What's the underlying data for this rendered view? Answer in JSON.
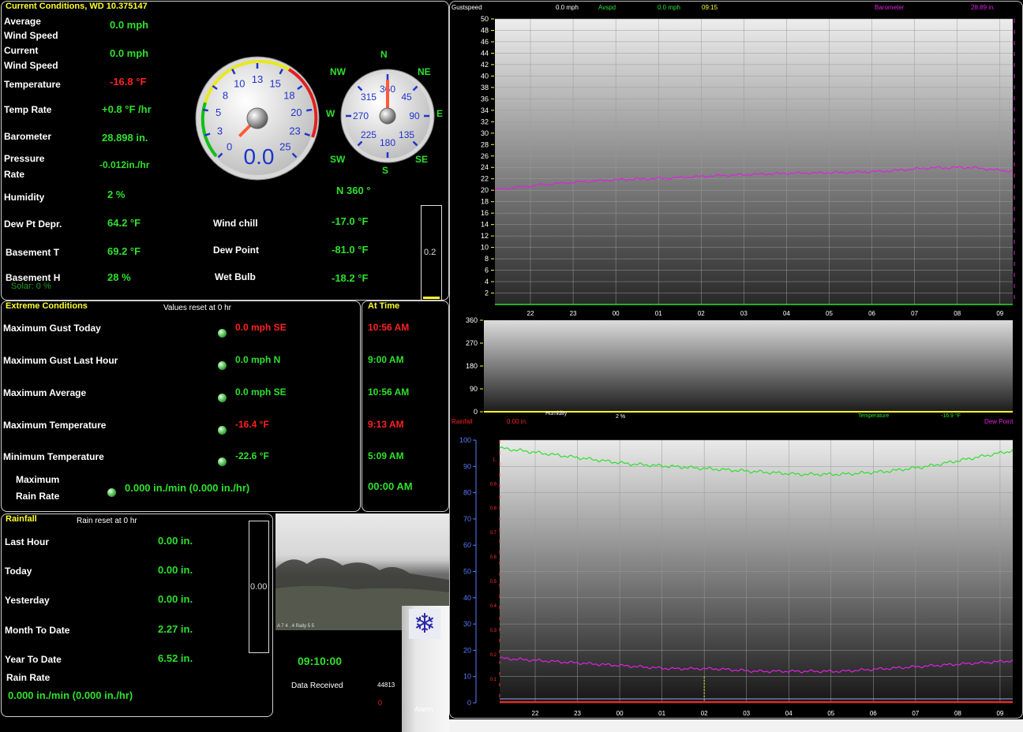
{
  "current": {
    "title": "Current Conditions, WD 10.375147",
    "avg_label_1": "Average",
    "avg_label_2": "Wind Speed",
    "avg_value": "0.0 mph",
    "cur_label_1": "Current",
    "cur_label_2": "Wind Speed",
    "cur_value": "0.0 mph",
    "temp_label": "Temperature",
    "temp_value": "-16.8 °F",
    "temprate_label": "Temp Rate",
    "temprate_value": "+0.8 °F /hr",
    "baro_label": "Barometer",
    "baro_value": "28.898 in.",
    "pres_label_1": "Pressure",
    "pres_label_2": "Rate",
    "pres_value": "-0.012in./hr",
    "hum_label": "Humidity",
    "hum_value": "2 %",
    "dew_depr_label": "Dew Pt Depr.",
    "dew_depr_value": "64.2 °F",
    "base_t_label": "Basement T",
    "base_t_value": "69.2 °F",
    "base_h_label": "Basement H",
    "base_h_value": "28 %",
    "solar": "Solar: 0 %",
    "windchill_label": "Wind chill",
    "windchill_value": "-17.0 °F",
    "dewpoint_label": "Dew Point",
    "dewpoint_value": "-81.0 °F",
    "wetbulb_label": "Wet Bulb",
    "wetbulb_value": "-18.2 °F",
    "speed_gauge": {
      "value": "0.0",
      "level": 0.0,
      "ticks": [
        "0",
        "3",
        "5",
        "8",
        "10",
        "13",
        "15",
        "18",
        "20",
        "23",
        "25"
      ]
    },
    "dir_gauge": {
      "readout": "N  360 °",
      "heading": 360,
      "ticks": [
        "360",
        "45",
        "90",
        "135",
        "180",
        "225",
        "270",
        "315"
      ],
      "compass": [
        "N",
        "NE",
        "E",
        "SE",
        "S",
        "SW",
        "W",
        "NW"
      ]
    },
    "solar_bar": {
      "value": "0.2",
      "level": 0.02
    }
  },
  "extreme": {
    "title": "Extreme Conditions",
    "reset_note": "Values reset at 0 hr",
    "at_time_title": "At Time",
    "rows": [
      {
        "label": "Maximum Gust Today",
        "value": "0.0 mph SE",
        "time": "10:56 AM",
        "value_color": "red",
        "time_color": "red"
      },
      {
        "label": "Maximum Gust Last Hour",
        "value": "0.0 mph  N",
        "time": "9:00 AM",
        "value_color": "green",
        "time_color": "green"
      },
      {
        "label": "Maximum Average",
        "value": "0.0 mph SE",
        "time": "10:56 AM",
        "value_color": "green",
        "time_color": "green"
      },
      {
        "label": "Maximum Temperature",
        "value": "-16.4 °F",
        "time": "9:13 AM",
        "value_color": "red",
        "time_color": "red"
      },
      {
        "label": "Minimum Temperature",
        "value": "-22.6 °F",
        "time": "5:09 AM",
        "value_color": "green",
        "time_color": "green"
      }
    ],
    "rain_label_1": "Maximum",
    "rain_label_2": "Rain Rate",
    "rain_value": "0.000 in./min (0.000 in./hr)",
    "rain_time": "00:00 AM"
  },
  "rainfall": {
    "title": "Rainfall",
    "reset_note": "Rain reset at 0 hr",
    "rows": [
      {
        "label": "Last Hour",
        "value": "0.00 in."
      },
      {
        "label": "Today",
        "value": "0.00 in."
      },
      {
        "label": "Yesterday",
        "value": "0.00 in."
      },
      {
        "label": "Month To Date",
        "value": "2.27 in."
      },
      {
        "label": "Year To Date",
        "value": "6.52 in."
      }
    ],
    "rate_label": "Rain Rate",
    "rate_value": "0.000 in./min (0.000 in./hr)",
    "bar_value": "0.00",
    "bar_level": 0.0
  },
  "status": {
    "clock": "09:10:00",
    "data_received_label": "Data Received",
    "data_received_count": "44813",
    "error_count": "0",
    "alarm_label": "Alarm",
    "webcam_caption": "A 7 4 . 4 Rally 5 5"
  },
  "chart_data": [
    {
      "type": "line",
      "title": "",
      "legend": [
        {
          "label": "Gustspeed",
          "value": "0.0 mph",
          "color": "#ffffff"
        },
        {
          "label": "Avspd",
          "value": "0.0 mph",
          "color": "#2ee02e"
        },
        {
          "label": "09:15",
          "value": "",
          "color": "#ffff30"
        },
        {
          "label": "Barometer",
          "value": "28.89 in.",
          "color": "#e020e0"
        }
      ],
      "x_ticks": [
        "22",
        "23",
        "00",
        "01",
        "02",
        "03",
        "04",
        "05",
        "06",
        "07",
        "08",
        "09"
      ],
      "ylim": [
        0,
        50
      ],
      "y_ticks": [
        2,
        4,
        6,
        8,
        10,
        12,
        14,
        16,
        18,
        20,
        22,
        24,
        26,
        28,
        30,
        32,
        34,
        36,
        38,
        40,
        42,
        44,
        46,
        48,
        50
      ],
      "series": [
        {
          "name": "Gustspeed",
          "color": "#ffffff",
          "values": [
            0,
            0,
            0,
            0,
            0,
            0,
            0,
            0,
            0,
            0,
            0,
            0
          ]
        },
        {
          "name": "Avspd",
          "color": "#2ee02e",
          "values": [
            0,
            0,
            0,
            0,
            0,
            0,
            0,
            0,
            0,
            0,
            0,
            0
          ]
        },
        {
          "name": "Barometer",
          "color": "#e020e0",
          "values": [
            20.1,
            20.9,
            21.5,
            21.9,
            22.1,
            22.5,
            22.8,
            23.0,
            23.1,
            23.3,
            23.9,
            24.0,
            23.3
          ]
        }
      ]
    },
    {
      "type": "line",
      "title": "",
      "ylim": [
        0,
        360
      ],
      "y_ticks": [
        0,
        90,
        180,
        270,
        360
      ],
      "series": [
        {
          "name": "Wind direction",
          "color": "#ffff30",
          "values": [
            0,
            0,
            0,
            0,
            0,
            0,
            0,
            0,
            0,
            0,
            0,
            0
          ]
        }
      ],
      "footer": [
        {
          "label": "Humidity",
          "value": "2 %",
          "color": "#ffffff"
        },
        {
          "label": "Temperature",
          "value": "-16.9 °F",
          "color": "#2ee02e"
        }
      ]
    },
    {
      "type": "line",
      "title": "",
      "legend": [
        {
          "label": "Rainfall",
          "value": "0.00 in.",
          "color": "#ff2020"
        },
        {
          "label": "Dew Point",
          "value": "",
          "color": "#e020e0"
        }
      ],
      "x_ticks": [
        "22",
        "23",
        "00",
        "01",
        "02",
        "03",
        "04",
        "05",
        "06",
        "07",
        "08",
        "09"
      ],
      "ylim": [
        0,
        100
      ],
      "y_ticks": [
        0,
        10,
        20,
        30,
        40,
        50,
        60,
        70,
        80,
        90,
        100
      ],
      "y2_ticks": [
        "0.1",
        "0.2",
        "0.3",
        "0.4",
        "0.5",
        "0.6",
        "0.7",
        "0.8",
        "0.9",
        "1."
      ],
      "series": [
        {
          "name": "Temperature",
          "color": "#2ee02e",
          "values": [
            97,
            95,
            93,
            91,
            90,
            89,
            88,
            87,
            87,
            88,
            90,
            93,
            96
          ]
        },
        {
          "name": "Dew Point",
          "color": "#e020e0",
          "values": [
            17,
            16,
            15,
            14,
            13,
            13,
            12,
            12,
            12,
            13,
            14,
            15,
            16
          ]
        },
        {
          "name": "Rainfall",
          "color": "#ff2020",
          "values": [
            0,
            0,
            0,
            0,
            0,
            0,
            0,
            0,
            0,
            0,
            0,
            0,
            0
          ]
        }
      ]
    }
  ]
}
